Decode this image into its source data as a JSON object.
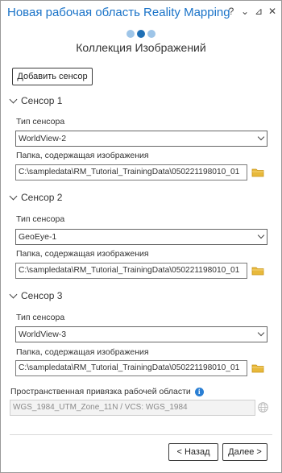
{
  "window": {
    "title": "Новая рабочая область Reality Mapping",
    "controls": {
      "help": "?",
      "menu": "⌄",
      "pin": "⊿",
      "close": "✕"
    }
  },
  "wizard": {
    "step_count": 3,
    "active_step": 2,
    "subtitle": "Коллекция Изображений"
  },
  "add_sensor_label": "Добавить сенсор",
  "sensors": [
    {
      "header": "Сенсор 1",
      "type_label": "Тип сенсора",
      "type_value": "WorldView-2",
      "folder_label": "Папка, содержащая изображения",
      "folder_value": "C:\\sampledata\\RM_Tutorial_TrainingData\\050221198010_01"
    },
    {
      "header": "Сенсор 2",
      "type_label": "Тип сенсора",
      "type_value": "GeoEye-1",
      "folder_label": "Папка, содержащая изображения",
      "folder_value": "C:\\sampledata\\RM_Tutorial_TrainingData\\050221198010_01"
    },
    {
      "header": "Сенсор 3",
      "type_label": "Тип сенсора",
      "type_value": "WorldView-3",
      "folder_label": "Папка, содержащая изображения",
      "folder_value": "C:\\sampledata\\RM_Tutorial_TrainingData\\050221198010_01"
    }
  ],
  "spatial_reference": {
    "label": "Пространственная привязка рабочей области",
    "value": "WGS_1984_UTM_Zone_11N / VCS: WGS_1984"
  },
  "footer": {
    "back_label": "< Назад",
    "next_label": "Далее >"
  },
  "colors": {
    "title": "#1a73c8",
    "step_active": "#1f6fb5",
    "step_inactive": "#9ec5e8",
    "folder": "#e8b93b",
    "info": "#2a7fd4"
  }
}
